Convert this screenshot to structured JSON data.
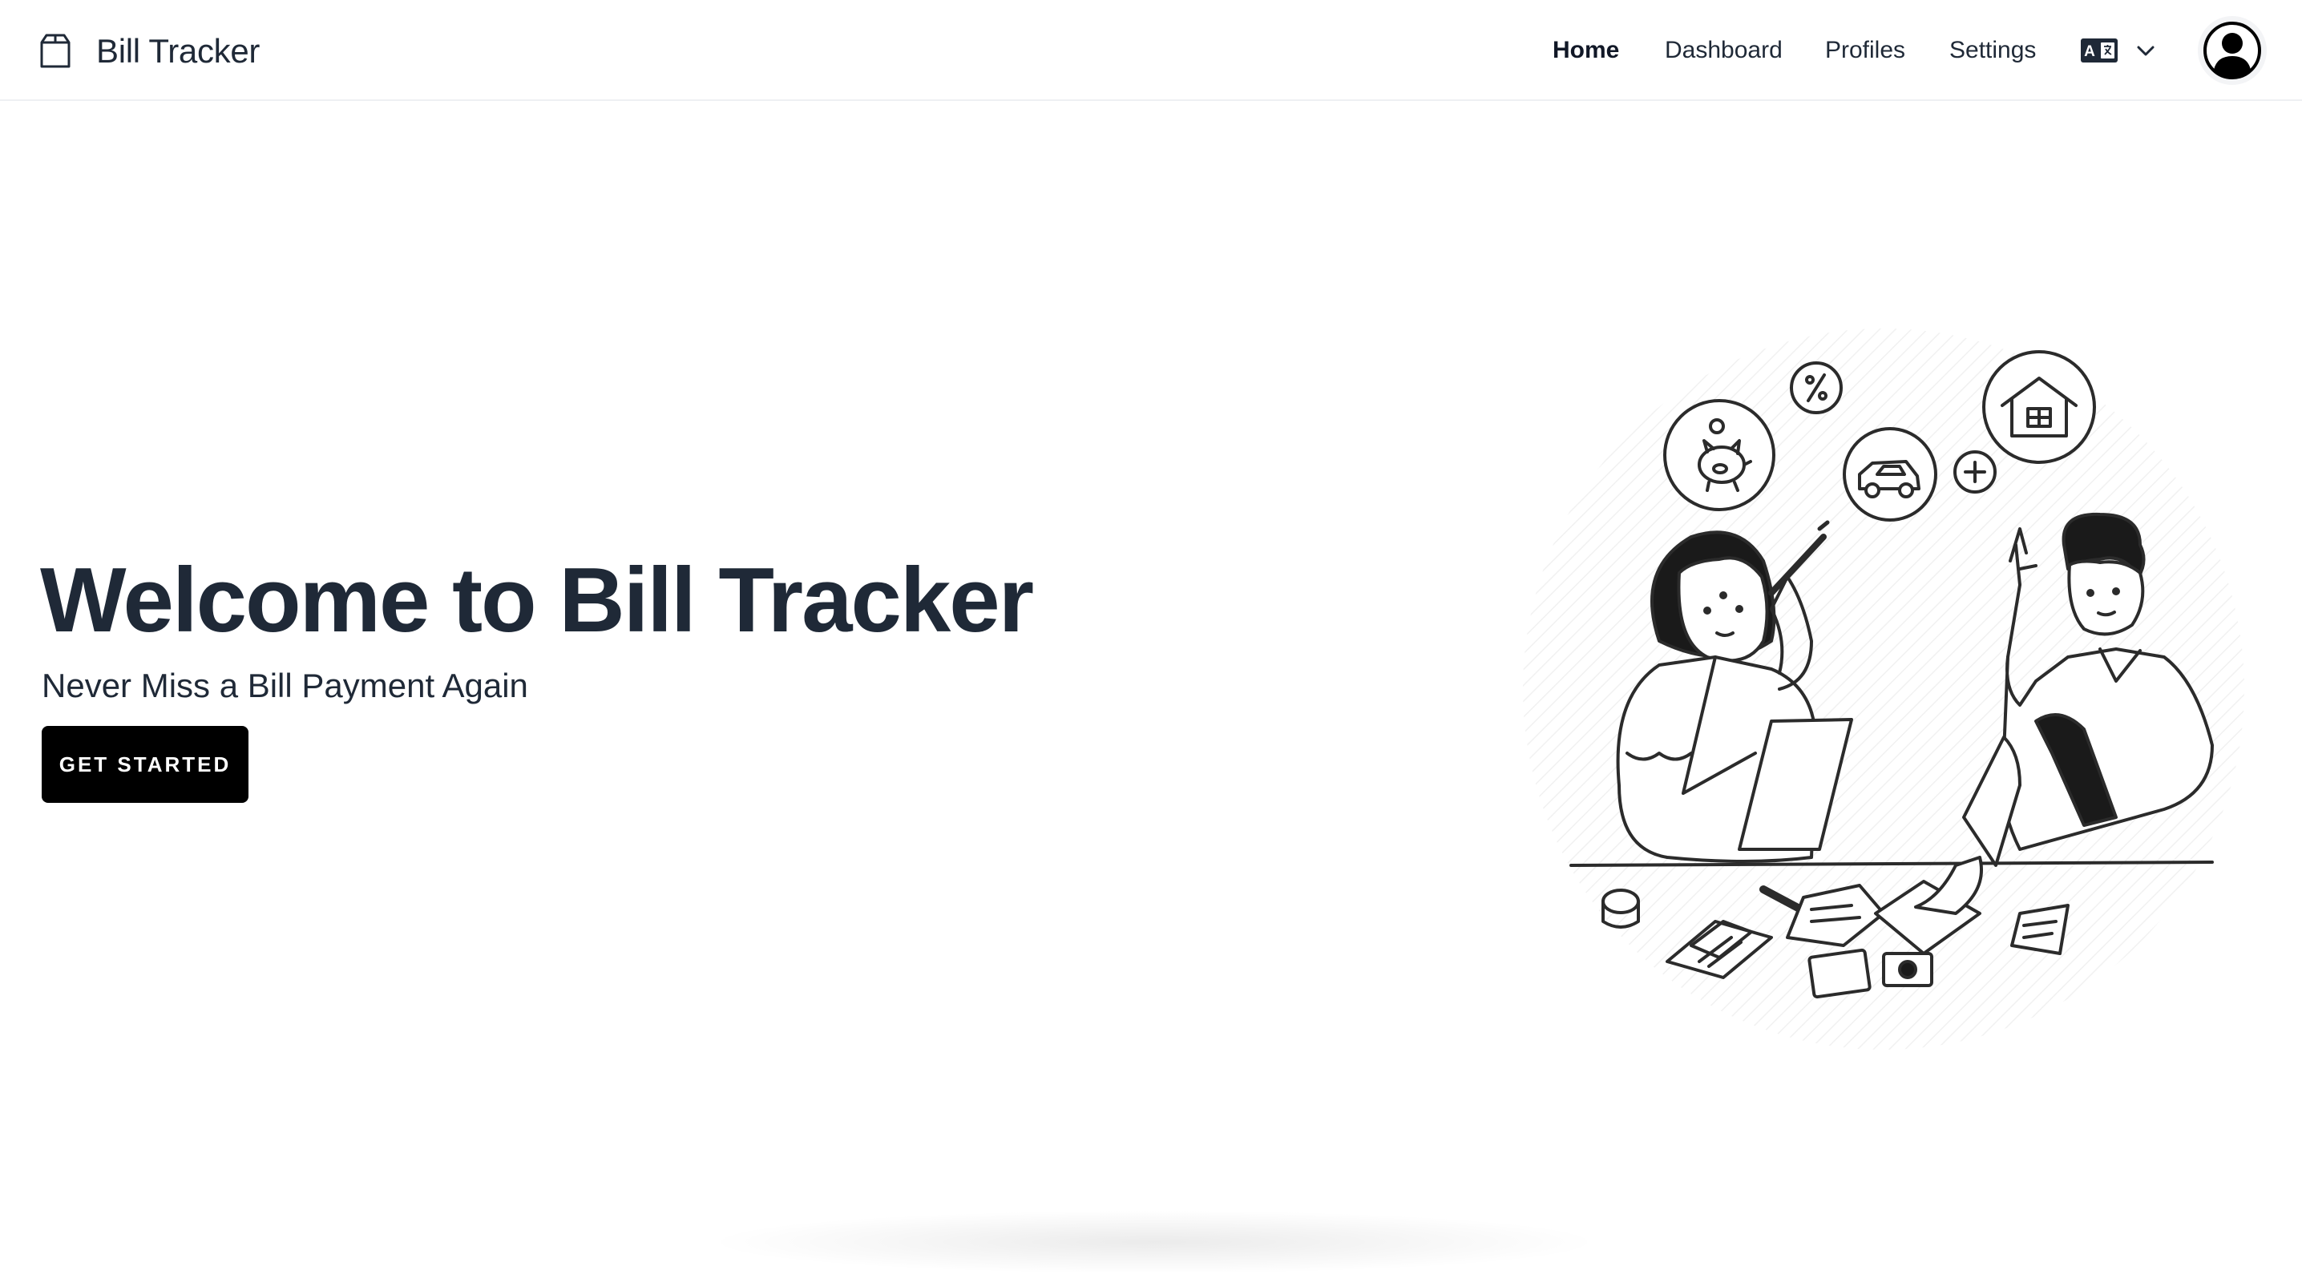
{
  "brand": {
    "name": "Bill Tracker",
    "icon": "package-box-icon"
  },
  "nav": {
    "items": [
      {
        "label": "Home",
        "active": true
      },
      {
        "label": "Dashboard",
        "active": false
      },
      {
        "label": "Profiles",
        "active": false
      },
      {
        "label": "Settings",
        "active": false
      }
    ],
    "language_icon": "language-translate-icon",
    "dropdown_icon": "chevron-down-icon",
    "avatar_icon": "user-circle-icon"
  },
  "hero": {
    "title": "Welcome to Bill Tracker",
    "subtitle": "Never Miss a Bill Payment Again",
    "cta_label": "GET STARTED"
  },
  "illustration": {
    "subject": "illustration",
    "icons": [
      "piggy-bank-icon",
      "percent-icon",
      "car-icon",
      "plus-icon",
      "house-icon",
      "calculator-icon",
      "receipt-icon"
    ]
  },
  "colors": {
    "text": "#1f2937",
    "cta_bg": "#000000",
    "cta_text": "#ffffff",
    "border": "#eef0f3"
  }
}
